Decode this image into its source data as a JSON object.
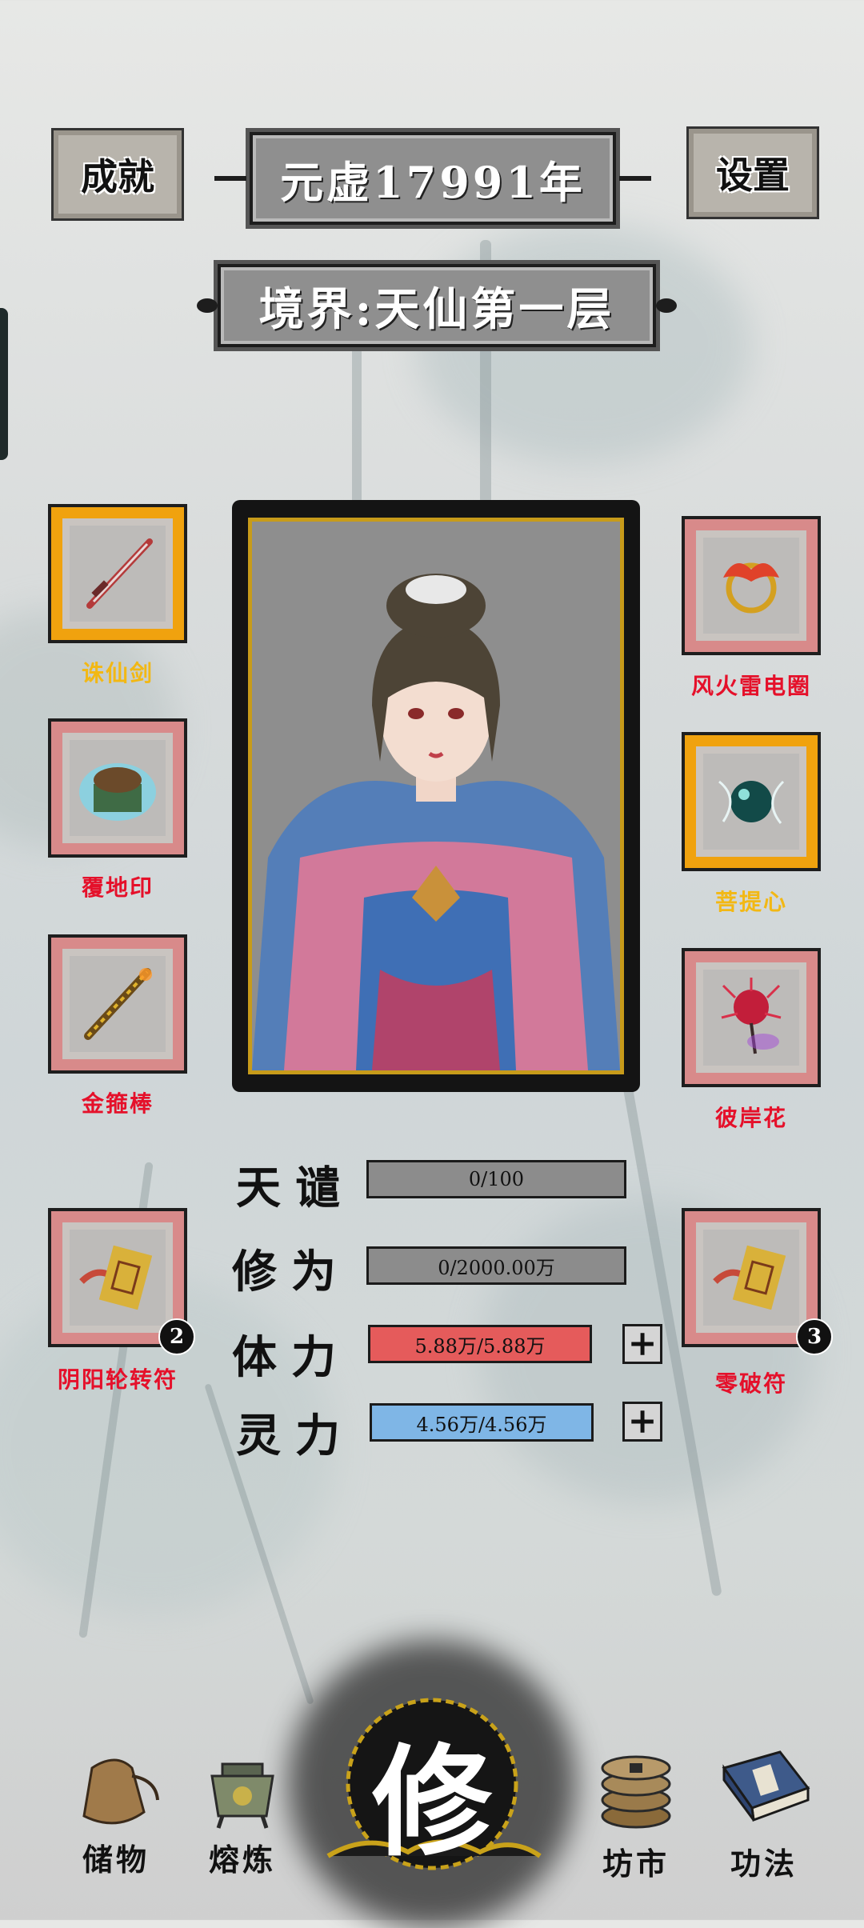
{
  "header": {
    "achievements_label": "成就",
    "year_label": "元虚17991年",
    "settings_label": "设置",
    "realm_label": "境界:天仙第一层"
  },
  "equipment": {
    "left": [
      {
        "name": "诛仙剑",
        "rarity_color": "#f2b814"
      },
      {
        "name": "覆地印",
        "rarity_color": "#e5102a"
      },
      {
        "name": "金箍棒",
        "rarity_color": "#e5102a"
      }
    ],
    "right": [
      {
        "name": "风火雷电圈",
        "rarity_color": "#e5102a"
      },
      {
        "name": "菩提心",
        "rarity_color": "#f2b814"
      },
      {
        "name": "彼岸花",
        "rarity_color": "#e5102a"
      }
    ]
  },
  "talismans": [
    {
      "name": "阴阳轮转符",
      "count": "2"
    },
    {
      "name": "零破符",
      "count": "3"
    }
  ],
  "stats": [
    {
      "label": "天谴",
      "value": "0/100",
      "fill": 0,
      "color": "#8c8c8c"
    },
    {
      "label": "修为",
      "value": "0/2000.00万",
      "fill": 0,
      "color": "#8c8c8c"
    },
    {
      "label": "体力",
      "value": "5.88万/5.88万",
      "fill": 1,
      "color": "#e55b5b"
    },
    {
      "label": "灵力",
      "value": "4.56万/4.56万",
      "fill": 1,
      "color": "#7fb6e6"
    }
  ],
  "stat_plus_label": "+",
  "nav": {
    "storage_label": "储物",
    "refine_label": "熔炼",
    "cultivate_label": "修",
    "market_label": "坊市",
    "skills_label": "功法"
  }
}
